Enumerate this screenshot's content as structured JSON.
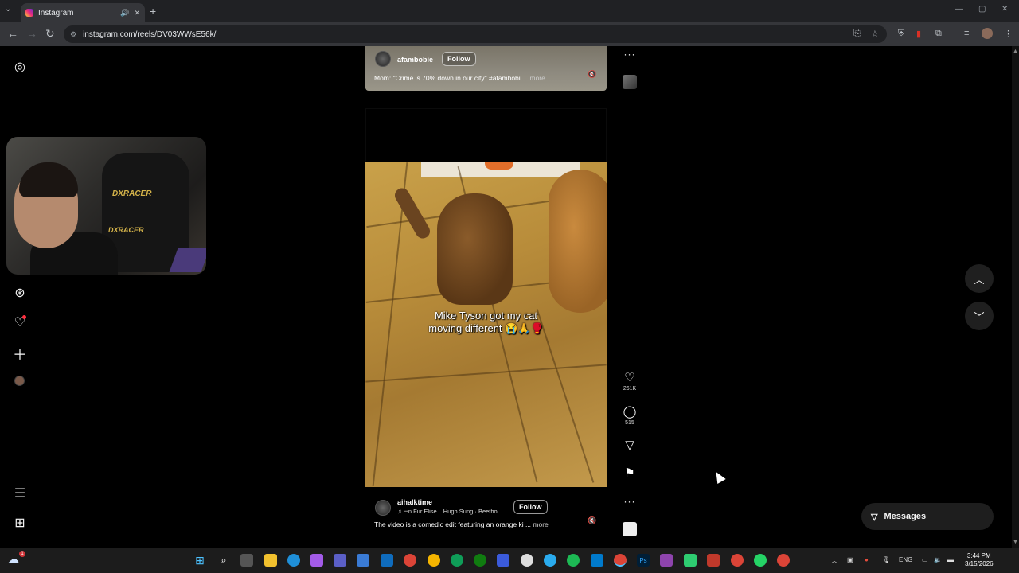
{
  "browser": {
    "tab_title": "Instagram",
    "url": "instagram.com/reels/DV03WWsE56k/",
    "new_tab": "+",
    "back": "←",
    "forward": "→",
    "reload": "↻"
  },
  "sidebar": {
    "logo_icon": "instagram-icon",
    "explore_icon": "compass-icon",
    "notifications_icon": "heart-icon",
    "create_icon": "plus-icon",
    "more_icon": "menu-icon",
    "meta_icon": "apps-icon"
  },
  "reels": [
    {
      "username": "afambobie",
      "follow_label": "Follow",
      "caption": "Mom: \"Crime is 70% down in our city\" #afambobi ...",
      "more_label": "more"
    },
    {
      "username": "aihalktime",
      "follow_label": "Follow",
      "music_left": "ꟷn Fur Elise",
      "music_right": "Hugh Sung · Beetho",
      "caption": "The video is a comedic edit featuring an orange ki ...",
      "more_label": "more",
      "overlay_line1": "Mike Tyson got my cat",
      "overlay_line2": "moving different 😭🙏🥊",
      "likes": "261K",
      "comments": "515"
    }
  ],
  "actions": {
    "like_icon": "heart-icon",
    "comment_icon": "comment-icon",
    "share_icon": "send-icon",
    "save_icon": "bookmark-icon",
    "more_icon": "more-icon"
  },
  "messages_label": "Messages",
  "taskbar": {
    "language": "ENG",
    "time": "3:44 PM",
    "date": "3/15/2026",
    "weather_badge": "1"
  }
}
